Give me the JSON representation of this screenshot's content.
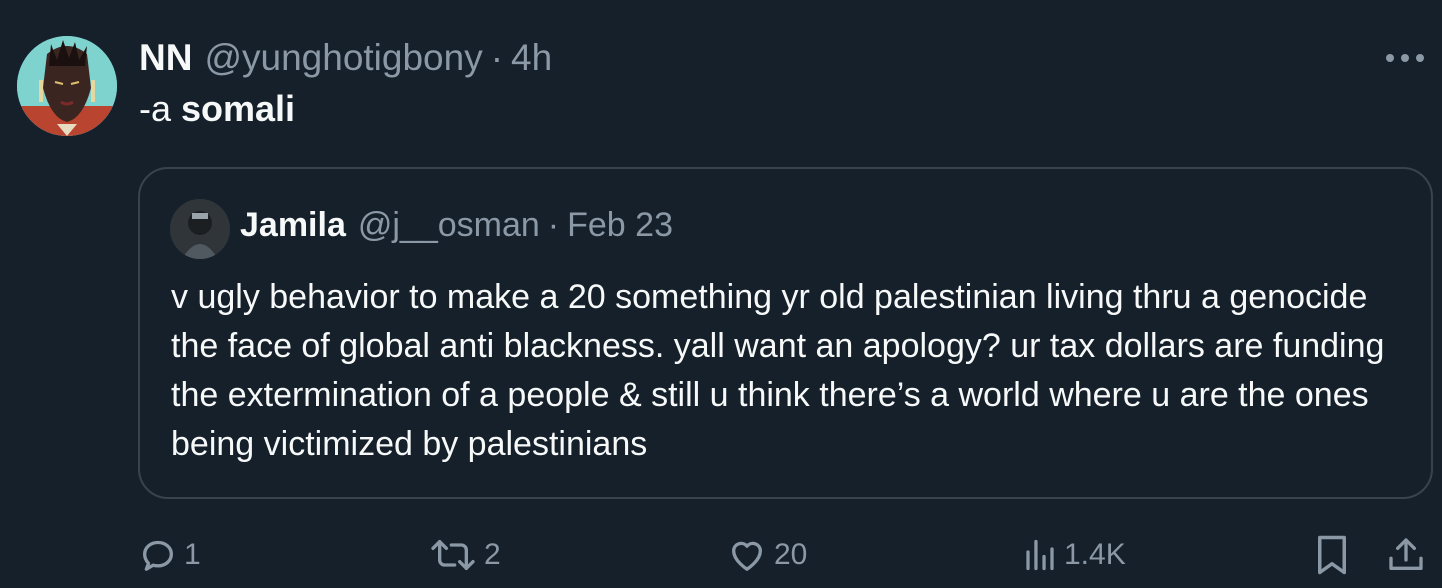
{
  "tweet": {
    "author_name": "NN",
    "author_handle": "@yunghotigbony",
    "separator": "·",
    "time": "4h",
    "text_prefix": "-a ",
    "text_bold": "somali"
  },
  "quote": {
    "author_name": "Jamila",
    "author_handle": "@j__osman",
    "separator": "·",
    "date": "Feb 23",
    "text": "v ugly behavior to make a 20 something yr old palestinian living thru a genocide the face of global anti blackness. yall want an apology? ur tax dollars are funding the extermination of a people & still u think there’s a world where u are the ones being victimized by palestinians"
  },
  "actions": {
    "replies": "1",
    "retweets": "2",
    "likes": "20",
    "views": "1.4K"
  },
  "icons": [
    "more-icon",
    "reply-icon",
    "retweet-icon",
    "like-icon",
    "views-icon",
    "bookmark-icon",
    "share-icon"
  ],
  "colors": {
    "background": "#15202b",
    "text_primary": "#f7f9f9",
    "text_secondary": "#8b98a5",
    "border": "#38444d"
  }
}
